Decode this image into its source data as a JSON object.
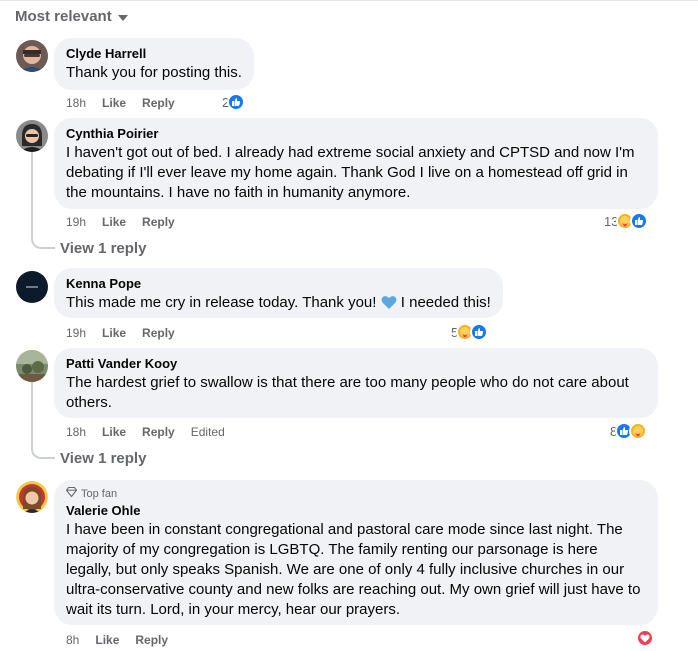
{
  "sort_label": "Most relevant",
  "colors": {
    "like": "#1877f2",
    "care": "#f7b125",
    "love": "#f33e58",
    "bubble": "#f0f2f5",
    "meta": "#65676b"
  },
  "comments": [
    {
      "author": "Clyde Harrell",
      "text": "Thank you for posting this.",
      "time": "18h",
      "like": "Like",
      "reply": "Reply",
      "reaction_count": "2",
      "reactions": [
        "like-icon"
      ]
    },
    {
      "author": "Cynthia Poirier",
      "text": "I haven't got out of bed. I already had extreme social anxiety and CPTSD and now I'm debating if I'll ever leave my home again. Thank God I live on a homestead off grid in the mountains. I have no faith in humanity anymore.",
      "time": "19h",
      "like": "Like",
      "reply": "Reply",
      "reaction_count": "13",
      "reactions": [
        "care-icon",
        "like-icon"
      ],
      "view_replies": "View 1 reply"
    },
    {
      "author": "Kenna Pope",
      "text_before": "This made me cry in release today. Thank you! ",
      "text_after": " I needed this!",
      "inline_icon": "blue-heart-icon",
      "time": "19h",
      "like": "Like",
      "reply": "Reply",
      "reaction_count": "5",
      "reactions": [
        "care-icon",
        "like-icon"
      ]
    },
    {
      "author": "Patti Vander Kooy",
      "text": "The hardest grief to swallow is that there are too many people who do not care about others.",
      "time": "18h",
      "like": "Like",
      "reply": "Reply",
      "edited": "Edited",
      "reaction_count": "8",
      "reactions": [
        "like-icon",
        "care-icon"
      ],
      "view_replies": "View 1 reply"
    },
    {
      "badge": "Top fan",
      "author": "Valerie Ohle",
      "text": "I have been in constant congregational and pastoral care mode since last night. The majority of my congregation is LGBTQ. The family renting our parsonage is here legally, but only speaks Spanish. We are one of only 4 fully inclusive churches in our ultra-conservative county and new folks are reaching out. My own grief will just have to wait its turn. Lord, in your mercy, hear our prayers.",
      "time": "8h",
      "like": "Like",
      "reply": "Reply",
      "reactions": [
        "love-icon"
      ]
    }
  ]
}
